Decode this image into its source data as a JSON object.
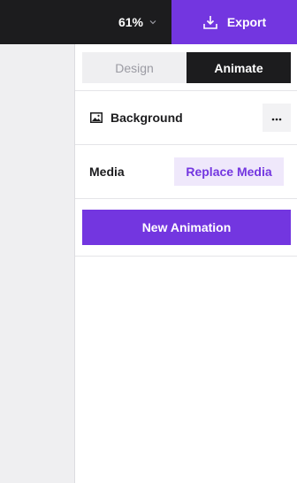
{
  "topbar": {
    "zoom_label": "61%",
    "export_label": "Export"
  },
  "panel": {
    "tabs": [
      {
        "label": "Design",
        "active": false
      },
      {
        "label": "Animate",
        "active": true
      }
    ],
    "background_label": "Background",
    "more_glyph": "···",
    "media_label": "Media",
    "replace_media_label": "Replace Media",
    "new_animation_label": "New Animation"
  },
  "icons": {
    "zoom_dropdown": "chevron-down-icon",
    "export": "download-icon",
    "background": "image-icon",
    "more": "more-horizontal-icon"
  },
  "colors": {
    "accent": "#7336e0",
    "accent_light": "#efe8fb",
    "topbar": "#1c1c1e"
  }
}
